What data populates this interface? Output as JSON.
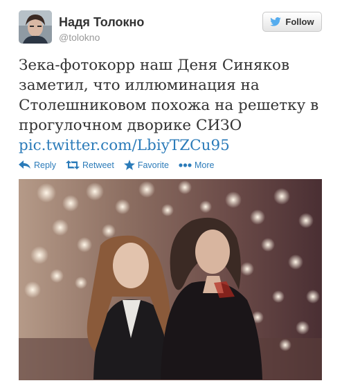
{
  "user": {
    "display_name": "Надя Толокно",
    "screen_name": "@tolokno",
    "avatar_icon": "user-avatar-photo"
  },
  "follow_button": {
    "label": "Follow",
    "icon": "twitter-bird-icon",
    "bird_color": "#55acee"
  },
  "tweet": {
    "text": "Зека-фотокорр наш Деня Синяков заметил, что иллюминация на Столешниковом похожа на решетку в прогулочном дворике СИЗО",
    "link": "pic.twitter.com/LbiyTZCu95",
    "link_color": "#2b7bb9"
  },
  "actions": [
    {
      "label": "Reply",
      "icon": "reply-arrow-icon"
    },
    {
      "label": "Retweet",
      "icon": "retweet-icon"
    },
    {
      "label": "Favorite",
      "icon": "star-icon"
    },
    {
      "label": "More",
      "icon": "more-dots-icon"
    }
  ],
  "photo": {
    "subject": "two-women-under-street-lights-photo"
  }
}
